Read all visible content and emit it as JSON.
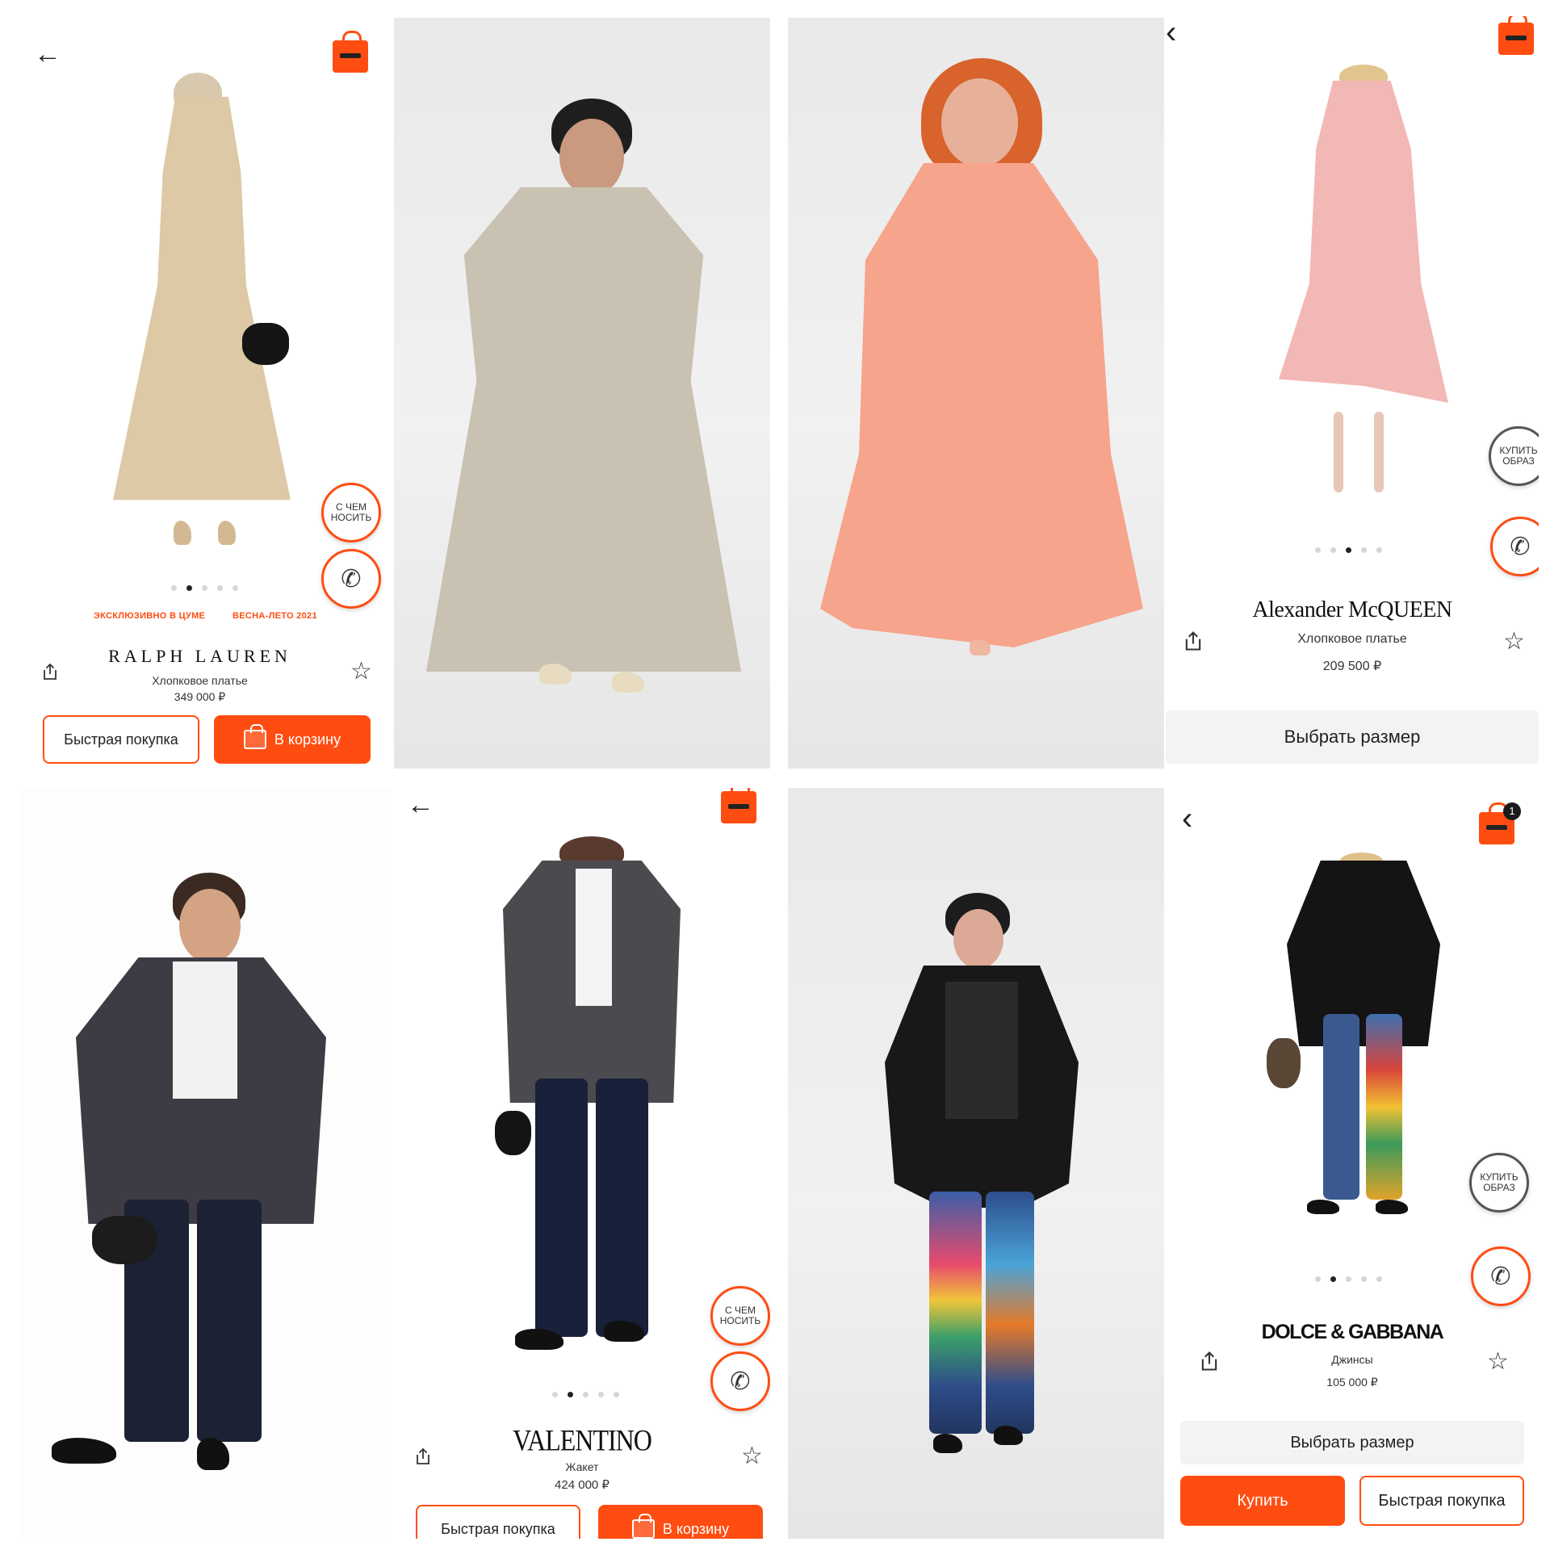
{
  "panels": {
    "ralph": {
      "tags": [
        "ЭКСКЛЮЗИВНО В ЦУМЕ",
        "ВЕСНА-ЛЕТО 2021"
      ],
      "brand": "RALPH LAUREN",
      "subtitle": "Хлопковое платье",
      "price": "349 000 ₽",
      "style_button": "С ЧЕМ\nНОСИТЬ",
      "quick_buy": "Быстрая покупка",
      "to_cart": "В корзину"
    },
    "mcqueen": {
      "brand": "Alexander McQUEEN",
      "subtitle": "Хлопковое платье",
      "price": "209 500 ₽",
      "look_button": "КУПИТЬ\nОБРАЗ",
      "choose_size": "Выбрать размер"
    },
    "valentino": {
      "brand": "VALENTINO",
      "subtitle": "Жакет",
      "price": "424 000 ₽",
      "style_button": "С ЧЕМ\nНОСИТЬ",
      "quick_buy": "Быстрая покупка",
      "to_cart": "В корзину"
    },
    "dolce": {
      "brand": "DOLCE & GABBANA",
      "subtitle": "Джинсы",
      "price": "105 000 ₽",
      "look_button": "КУПИТЬ\nОБРАЗ",
      "cart_count": "1",
      "choose_size": "Выбрать размер",
      "buy": "Купить",
      "quick_buy": "Быстрая покупка"
    }
  },
  "icons": [
    "back-arrow-icon",
    "shopping-bag-icon",
    "phone-icon",
    "share-icon",
    "star-icon"
  ],
  "colors": {
    "accent": "#ff4d12",
    "text": "#1b1b1b",
    "muted_button": "#f3f3f5",
    "photo_background": "#ececec"
  }
}
